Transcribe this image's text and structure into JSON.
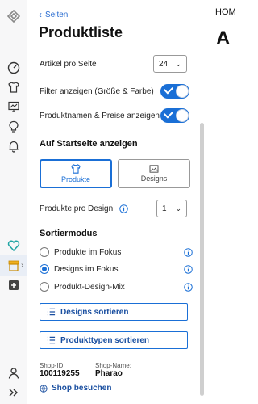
{
  "rail": {
    "icons": [
      "logo-icon",
      "dashboard-icon",
      "tshirt-icon",
      "design-icon",
      "lightbulb-icon",
      "bell-icon",
      "heart-check-icon",
      "shop-icon",
      "plus-box-icon",
      "user-icon",
      "double-chevron-icon"
    ]
  },
  "panel": {
    "back_label": "Seiten",
    "title": "Produktliste",
    "items_per_page_label": "Artikel pro Seite",
    "items_per_page_value": "24",
    "filter_label": "Filter anzeigen (Größe & Farbe)",
    "names_prices_label": "Produktnamen & Preise anzeigen",
    "startpage_heading": "Auf Startseite anzeigen",
    "tab_products": "Produkte",
    "tab_designs": "Designs",
    "products_per_design_label": "Produkte pro Design",
    "products_per_design_value": "1",
    "sort_heading": "Sortiermodus",
    "sort_options": [
      "Produkte im Fokus",
      "Designs im Fokus",
      "Produkt-Design-Mix"
    ],
    "sort_selected": "Designs im Fokus",
    "sort_designs_btn": "Designs sortieren",
    "sort_types_btn": "Produkttypen sortieren",
    "shop_id_label": "Shop-ID:",
    "shop_id_value": "100119255",
    "shop_name_label": "Shop-Name:",
    "shop_name_value": "Pharao",
    "visit_shop": "Shop besuchen"
  },
  "preview": {
    "nav_text": "HOM",
    "heading_text": "A"
  },
  "colors": {
    "accent": "#1a6fd6",
    "link": "#1a4fa0"
  }
}
